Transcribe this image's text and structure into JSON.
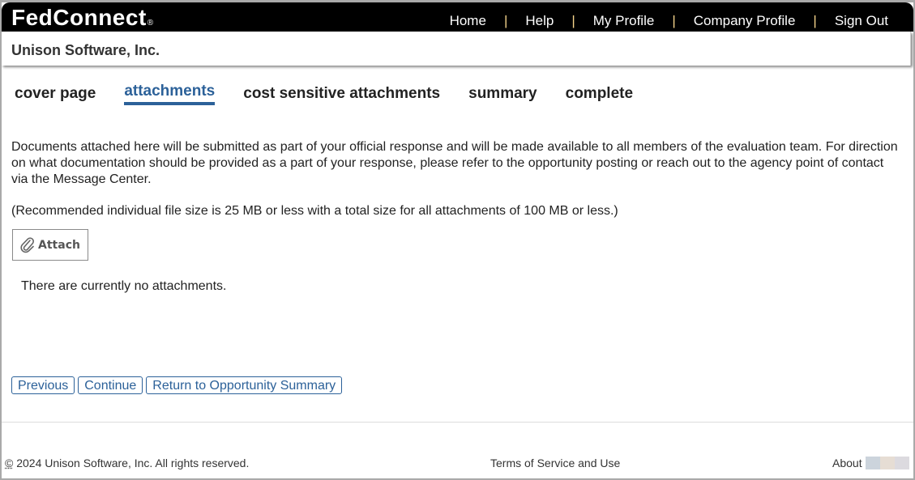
{
  "header": {
    "logo": "FedConnect",
    "logo_mark": "®",
    "nav": [
      "Home",
      "Help",
      "My Profile",
      "Company Profile",
      "Sign Out"
    ],
    "separator": "|"
  },
  "company": {
    "name": "Unison Software, Inc."
  },
  "tabs": [
    {
      "label": "cover page",
      "active": false
    },
    {
      "label": "attachments",
      "active": true
    },
    {
      "label": "cost sensitive attachments",
      "active": false
    },
    {
      "label": "summary",
      "active": false
    },
    {
      "label": "complete",
      "active": false
    }
  ],
  "main": {
    "description": "Documents attached here will be submitted as part of your official response and will be made available to all members of the evaluation team. For direction on what documentation should be provided as a part of your response, please refer to the opportunity posting or reach out to the agency point of contact via the Message Center.",
    "file_size_note": "(Recommended individual file size is 25 MB or less with a total size for all attachments of 100 MB or less.)",
    "attach_button": "Attach",
    "attach_icon": "paperclip-icon",
    "empty_message": "There are currently no attachments."
  },
  "actions": {
    "previous": "Previous",
    "continue": "Continue",
    "return": "Return to Opportunity Summary"
  },
  "footer": {
    "copyright_symbol": "©",
    "copyright": " 2024 Unison Software, Inc. All rights reserved.",
    "terms": "Terms of Service and Use",
    "about": "About",
    "swatch_colors": [
      "#ccd4dc",
      "#e6ddd4",
      "#dcdadf"
    ]
  },
  "colors": {
    "accent": "#2c6199",
    "topbar": "#000000",
    "separator": "#f5d48a"
  }
}
